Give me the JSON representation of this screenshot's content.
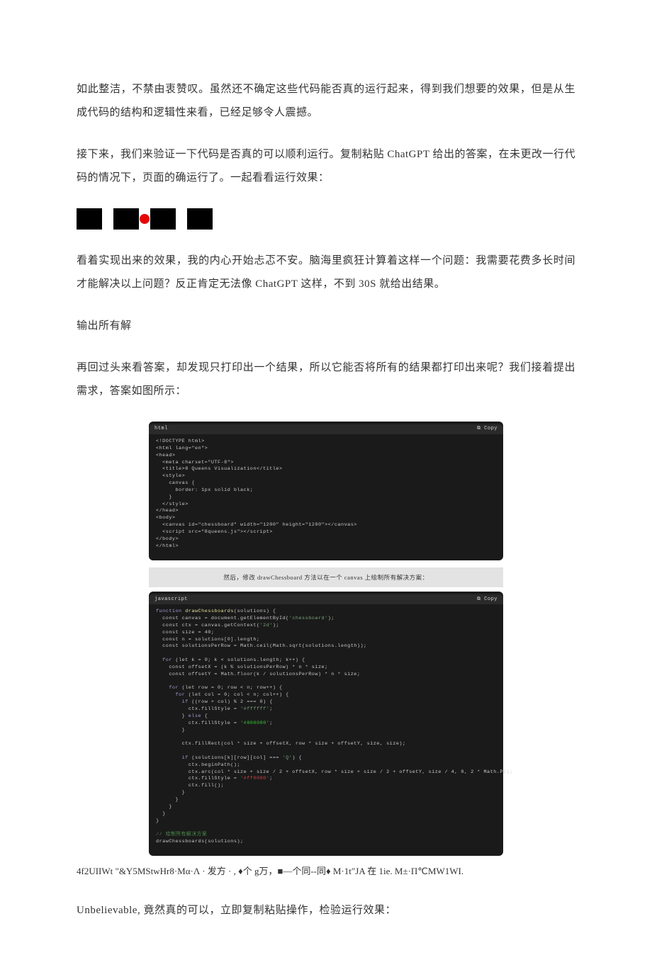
{
  "paragraphs": {
    "p1": "如此整洁，不禁由衷赞叹。虽然还不确定这些代码能否真的运行起来，得到我们想要的效果，但是从生成代码的结构和逻辑性来看，已经足够令人震撼。",
    "p2": "接下来，我们来验证一下代码是否真的可以顺利运行。复制粘贴 ChatGPT 给出的答案，在未更改一行代码的情况下，页面的确运行了。一起看看运行效果：",
    "p3": "看着实现出来的效果，我的内心开始忐忑不安。脑海里疯狂计算着这样一个问题：我需要花费多长时间才能解决以上问题？反正肯定无法像 ChatGPT 这样，不到 30S 就给出结果。",
    "h1": "输出所有解",
    "p4": "再回过头来看答案，却发现只打印出一个结果，所以它能否将所有的结果都打印出来呢？我们接着提出需求，答案如图所示：",
    "ocr": "4f2UIIWt \"&Y5MStwHr8·Mα·Λ · 发方 · , ♦个 g万，■—个同--同♦ M·1t″JA 在 1ie. M±·Π℃MW1WI.",
    "p5": "Unbelievable, 竟然真的可以，立即复制粘贴操作，检验运行效果："
  },
  "code1": {
    "lang": "html",
    "copy": "⧉ Copy",
    "lines": [
      "<!DOCTYPE html>",
      "<html lang=\"en\">",
      "<head>",
      "  <meta charset=\"UTF-8\">",
      "  <title>8 Queens Visualization</title>",
      "  <style>",
      "    canvas {",
      "      border: 1px solid black;",
      "    }",
      "  </style>",
      "</head>",
      "<body>",
      "  <canvas id=\"chessboard\" width=\"1200\" height=\"1200\"></canvas>",
      "  <script src=\"8queens.js\"></script>",
      "</body>",
      "</html>"
    ]
  },
  "graybar": "然后，修改 drawChessboard 方法以在一个 canvas 上绘制所有解决方案：",
  "code2": {
    "lang": "javascript",
    "copy": "⧉ Copy"
  },
  "code2_lines": {
    "l1a": "function",
    "l1b": " drawChessboards",
    "l1c": "(solutions) {",
    "l2": "  const canvas = document.getElementById(",
    "l2s": "'chessboard'",
    "l2e": ");",
    "l3": "  const ctx = canvas.getContext(",
    "l3s": "'2d'",
    "l3e": ");",
    "l4": "  const size = 40;",
    "l5": "  const n = solutions[0].length;",
    "l6": "  const solutionsPerRow = Math.ceil(Math.sqrt(solutions.length));",
    "bl": " ",
    "l7a": "  for",
    "l7b": " (let k = 0; k < solutions.length; k++) {",
    "l8": "    const offsetX = (k % solutionsPerRow) * n * size;",
    "l9": "    const offsetY = Math.floor(k / solutionsPerRow) * n * size;",
    "l10a": "    for",
    "l10b": " (let row = 0; row < n; row++) {",
    "l11a": "      for",
    "l11b": " (let col = 0; col < n; col++) {",
    "l12a": "        if",
    "l12b": " ((row + col) % 2 === 0) {",
    "l13": "          ctx.fillStyle = ",
    "l13s": "'#ffffff'",
    "l13e": ";",
    "l14a": "        } ",
    "l14b": "else",
    "l14c": " {",
    "l15": "          ctx.fillStyle = ",
    "l15s": "'#000000'",
    "l15e": ";",
    "l16": "        }",
    "l17": "        ctx.fillRect(col * size + offsetX, row * size + offsetY, size, size);",
    "l18a": "        if",
    "l18b": " (solutions[k][row][col] === ",
    "l18s": "'Q'",
    "l18e": ") {",
    "l19": "          ctx.beginPath();",
    "l20": "          ctx.arc(col * size + size / 2 + offsetX, row * size + size / 2 + offsetY, size / 4, 0, 2 * Math.PI);",
    "l21": "          ctx.fillStyle = ",
    "l21s": "'#ff0000'",
    "l21e": ";",
    "l22": "          ctx.fill();",
    "l23": "        }",
    "l24": "      }",
    "l25": "    }",
    "l26": "  }",
    "l27": "}",
    "c1": "// 绘制所有解决方案",
    "l28": "drawChessboards(solutions);"
  }
}
